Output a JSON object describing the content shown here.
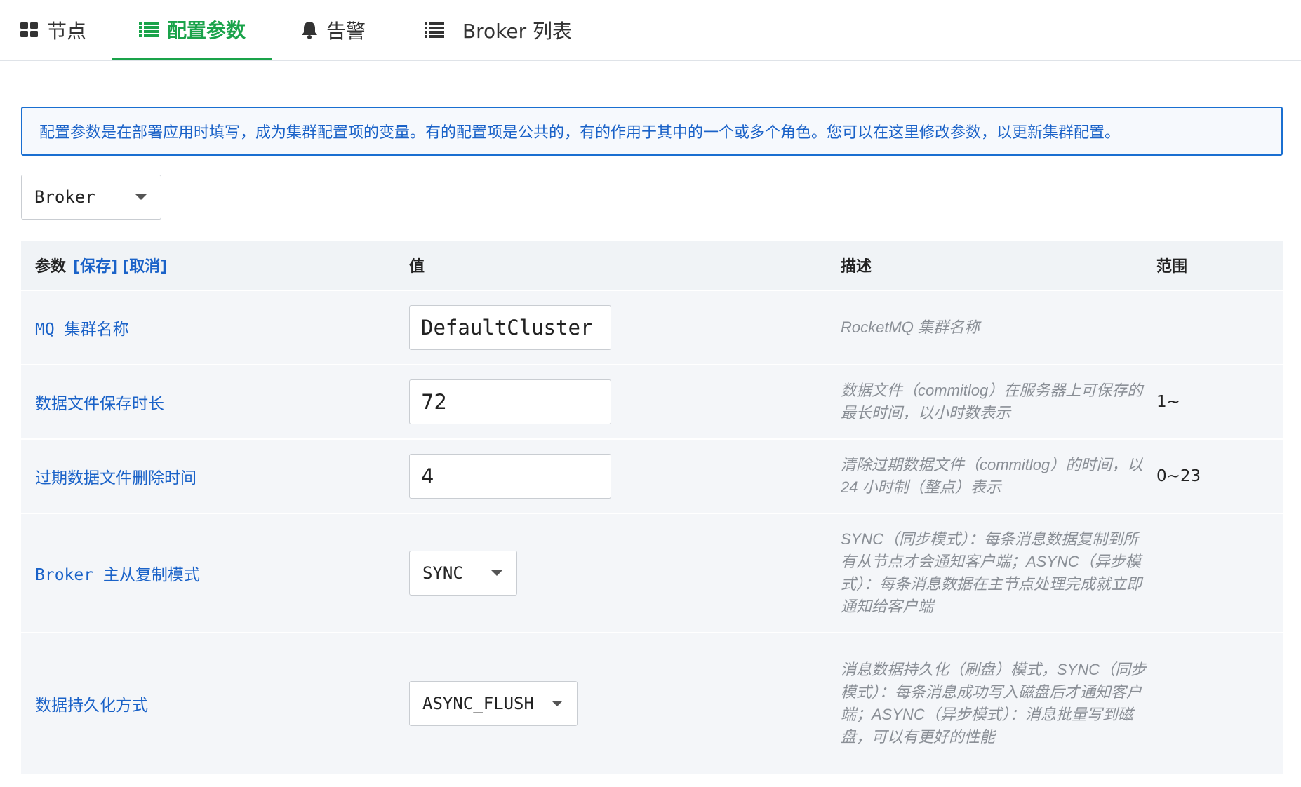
{
  "tabs": [
    {
      "label": "节点",
      "icon": "grid-icon"
    },
    {
      "label": "配置参数",
      "icon": "list-icon",
      "active": true
    },
    {
      "label": "告警",
      "icon": "bell-icon"
    },
    {
      "label": "Broker 列表",
      "icon": "list-icon"
    }
  ],
  "info_text": "配置参数是在部署应用时填写，成为集群配置项的变量。有的配置项是公共的，有的作用于其中的一个或多个角色。您可以在这里修改参数，以更新集群配置。",
  "role_select": {
    "value": "Broker"
  },
  "table": {
    "headers": {
      "param": "参数",
      "save": "[保存]",
      "cancel": "[取消]",
      "value": "值",
      "desc": "描述",
      "range": "范围"
    },
    "rows": [
      {
        "name": "MQ 集群名称",
        "value": "DefaultCluster",
        "control": "input",
        "desc": "RocketMQ 集群名称",
        "range": ""
      },
      {
        "name": "数据文件保存时长",
        "value": "72",
        "control": "input",
        "desc": "数据文件（commitlog）在服务器上可保存的最长时间，以小时数表示",
        "range": "1~"
      },
      {
        "name": "过期数据文件删除时间",
        "value": "4",
        "control": "input",
        "desc": "清除过期数据文件（commitlog）的时间，以 24 小时制（整点）表示",
        "range": "0~23"
      },
      {
        "name": "Broker 主从复制模式",
        "value": "SYNC",
        "control": "select",
        "desc": "SYNC（同步模式）：每条消息数据复制到所有从节点才会通知客户端；ASYNC（异步模式）：每条消息数据在主节点处理完成就立即通知给客户端",
        "range": ""
      },
      {
        "name": "数据持久化方式",
        "value": "ASYNC_FLUSH",
        "control": "select",
        "desc": "消息数据持久化（刷盘）模式，SYNC（同步模式）：每条消息成功写入磁盘后才通知客户端；ASYNC（异步模式）：消息批量写到磁盘，可以有更好的性能",
        "range": ""
      }
    ]
  },
  "colors": {
    "accent_green": "#1aa34a",
    "link_blue": "#1a62c8",
    "row_bg": "#f4f6f9"
  }
}
